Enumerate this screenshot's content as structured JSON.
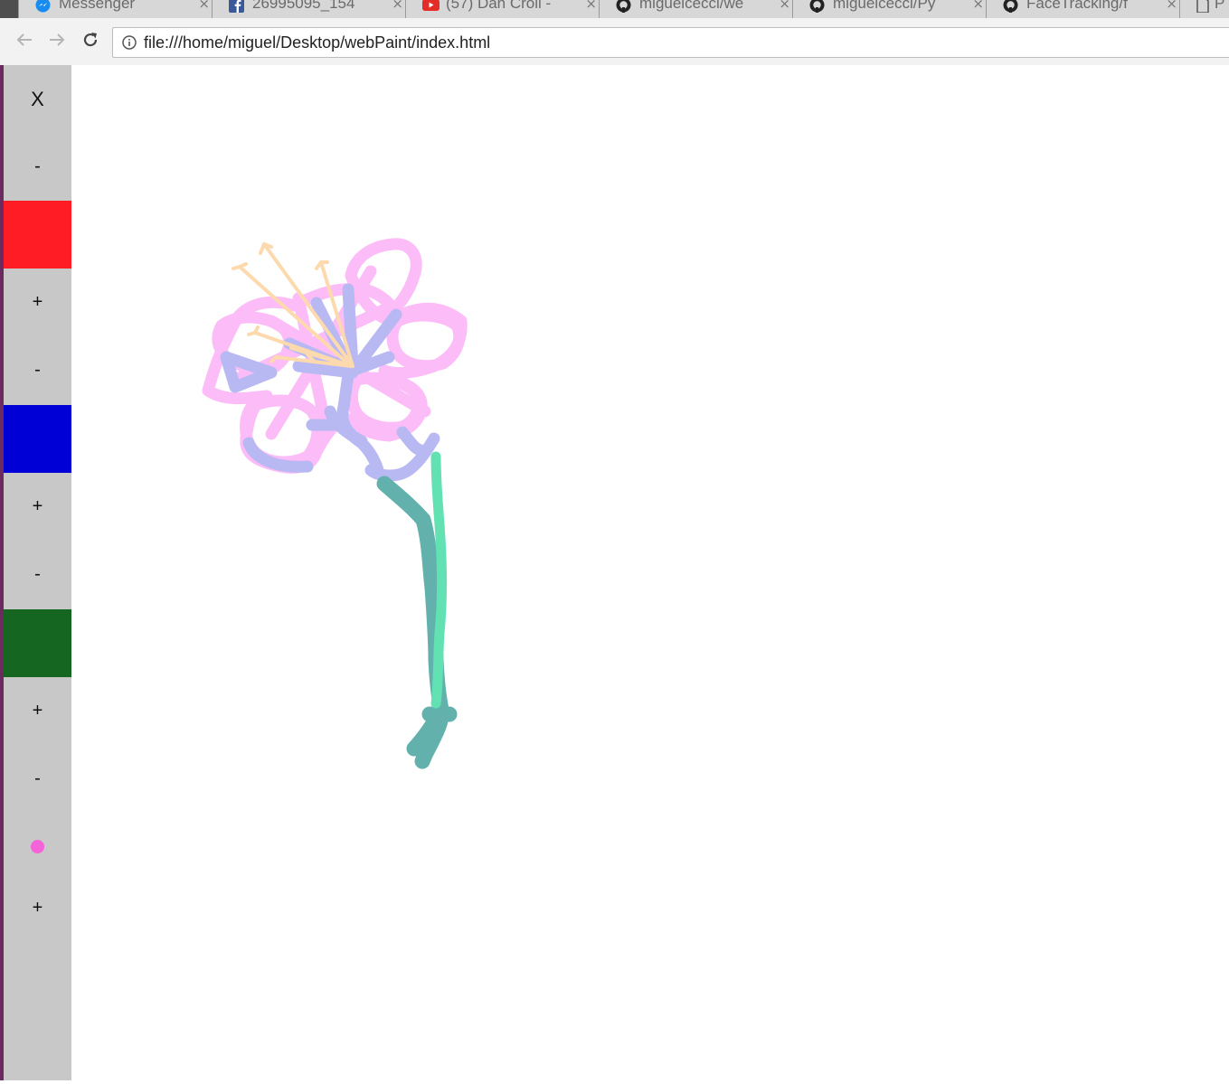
{
  "browser": {
    "tabs": [
      {
        "title": "Messenger",
        "icon": "messenger-icon",
        "close": "×"
      },
      {
        "title": "26995095_154",
        "icon": "facebook-icon",
        "close": "×"
      },
      {
        "title": "(57) Dan Croll -",
        "icon": "youtube-icon",
        "close": "×"
      },
      {
        "title": "miguelcecci/we",
        "icon": "github-icon",
        "close": "×"
      },
      {
        "title": "miguelcecci/Py",
        "icon": "github-icon",
        "close": "×"
      },
      {
        "title": "FaceTracking/f",
        "icon": "github-icon",
        "close": "×"
      },
      {
        "title": "P",
        "icon": "page-icon",
        "close": ""
      }
    ],
    "address": "file:///home/miguel/Desktop/webPaint/index.html"
  },
  "sidebar": {
    "clear_label": "X",
    "red": {
      "minus": "-",
      "plus": "+",
      "color": "#ff1c24"
    },
    "blue": {
      "minus": "-",
      "plus": "+",
      "color": "#0000d6"
    },
    "green": {
      "minus": "-",
      "plus": "+",
      "color": "#146620"
    },
    "size": {
      "minus": "-",
      "plus": "+"
    },
    "brush_color": "#f562d9"
  },
  "colors": {
    "petal": "#fcbcf8",
    "center": "#b8b9f2",
    "stamen": "#fdd9ae",
    "stem_dark": "#62b1ad",
    "stem_light": "#62e1b2"
  }
}
